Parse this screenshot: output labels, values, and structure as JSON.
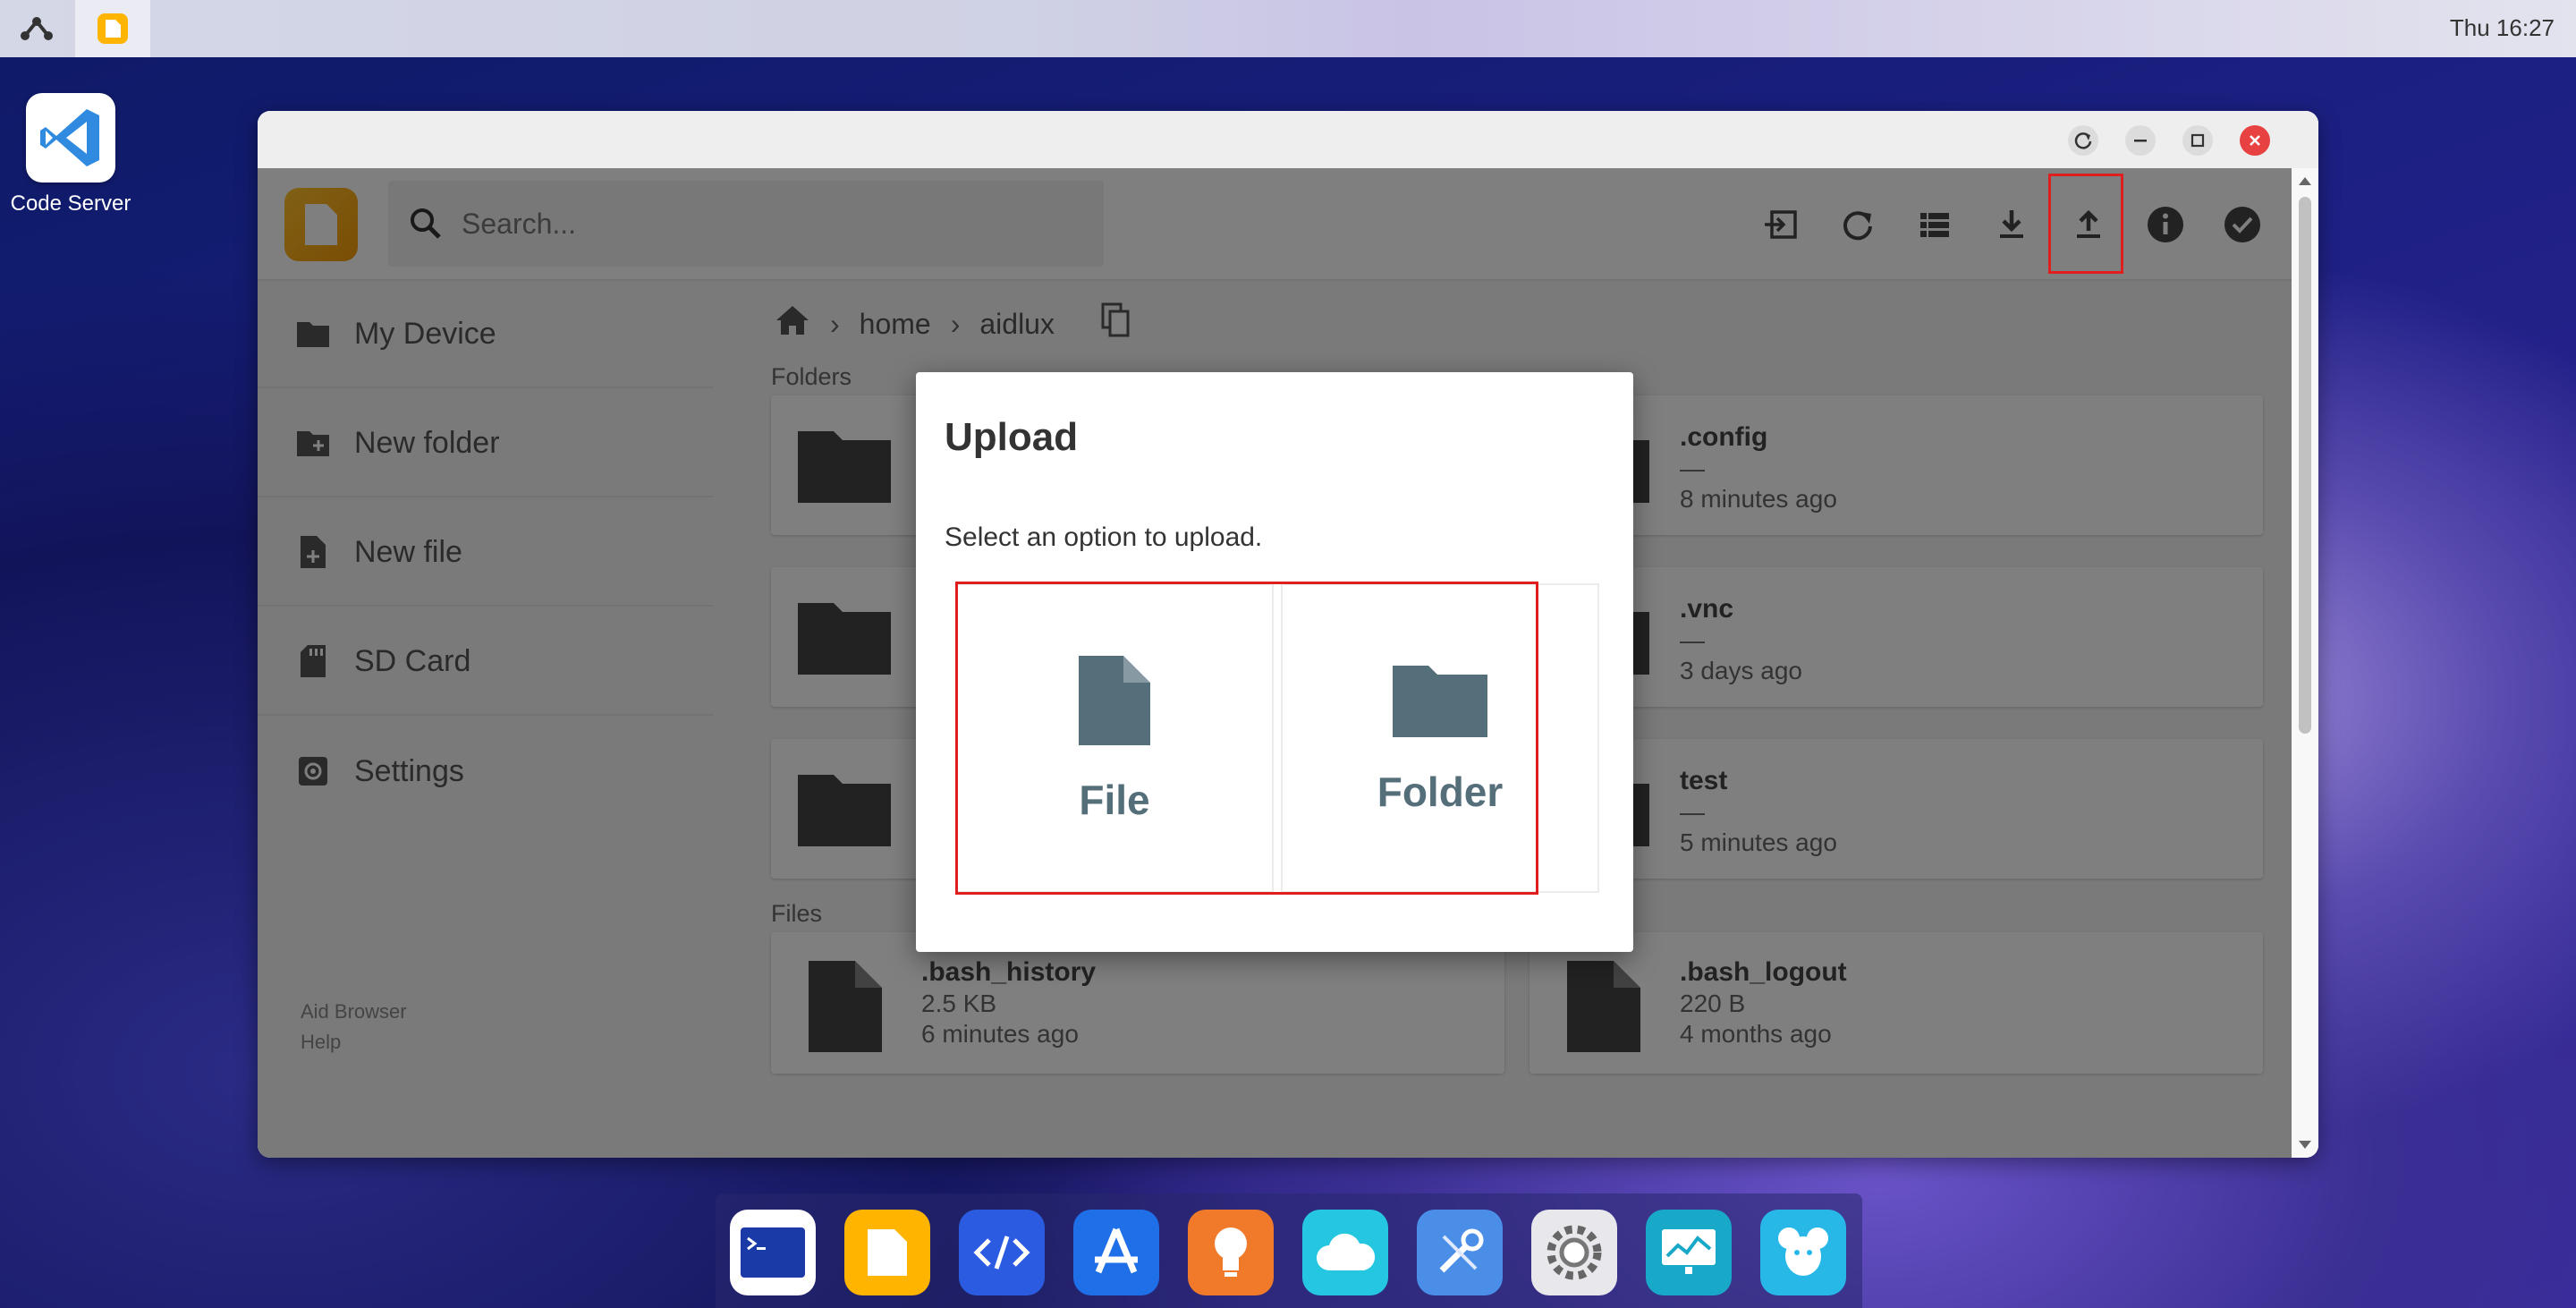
{
  "topbar": {
    "clock": "Thu 16:27"
  },
  "desktop": {
    "icon_label": "Code Server"
  },
  "window": {
    "search_placeholder": "Search..."
  },
  "sidebar": {
    "items": [
      {
        "label": "My Device",
        "icon": "folder-icon"
      },
      {
        "label": "New folder",
        "icon": "new-folder-icon"
      },
      {
        "label": "New file",
        "icon": "new-file-icon"
      },
      {
        "label": "SD Card",
        "icon": "sd-card-icon"
      },
      {
        "label": "Settings",
        "icon": "gear-icon"
      }
    ],
    "links": [
      "Aid Browser",
      "Help"
    ]
  },
  "breadcrumb": [
    "home",
    "aidlux"
  ],
  "sections": {
    "folders": "Folders",
    "files": "Files"
  },
  "folders": [
    {
      "name": ".config",
      "size": "—",
      "modified": "8 minutes ago"
    },
    {
      "name": ".vnc",
      "size": "—",
      "modified": "3 days ago"
    },
    {
      "name": "test",
      "size": "—",
      "modified": "5 minutes ago"
    }
  ],
  "files": [
    {
      "name": ".bash_history",
      "size": "2.5 KB",
      "modified": "6 minutes ago"
    },
    {
      "name": ".bash_logout",
      "size": "220 B",
      "modified": "4 months ago"
    }
  ],
  "dialog": {
    "title": "Upload",
    "description": "Select an option to upload.",
    "options": {
      "file": "File",
      "folder": "Folder"
    }
  },
  "colors": {
    "highlight": "#e01e1e",
    "option_icon": "#546e7a",
    "close": "#e84141"
  }
}
